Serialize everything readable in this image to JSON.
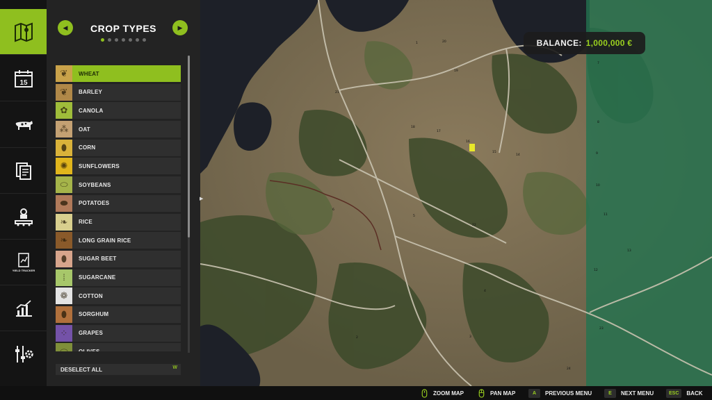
{
  "sidebar": {
    "items": [
      {
        "name": "map-icon",
        "active": true
      },
      {
        "name": "calendar-icon",
        "day": "15"
      },
      {
        "name": "cow-icon"
      },
      {
        "name": "documents-icon"
      },
      {
        "name": "production-icon"
      },
      {
        "name": "yield-tracker-icon",
        "label": "YIELD TRACKER"
      },
      {
        "name": "statistics-icon"
      },
      {
        "name": "settings-icon"
      }
    ]
  },
  "panel": {
    "title": "CROP TYPES",
    "page_count": 7,
    "active_page": 1,
    "crops": [
      {
        "label": "WHEAT",
        "glyph": "❦",
        "color": "#c9a24a",
        "selected": true
      },
      {
        "label": "BARLEY",
        "glyph": "❦",
        "color": "#b08848"
      },
      {
        "label": "CANOLA",
        "glyph": "✿",
        "color": "#9fbd3a"
      },
      {
        "label": "OAT",
        "glyph": "⁂",
        "color": "#c4a173"
      },
      {
        "label": "CORN",
        "glyph": "⬮",
        "color": "#d9b23a"
      },
      {
        "label": "SUNFLOWERS",
        "glyph": "✺",
        "color": "#e0b51c"
      },
      {
        "label": "SOYBEANS",
        "glyph": "⬭",
        "color": "#a5b44a"
      },
      {
        "label": "POTATOES",
        "glyph": "⬬",
        "color": "#b07a5a"
      },
      {
        "label": "RICE",
        "glyph": "❧",
        "color": "#d8cf8e"
      },
      {
        "label": "LONG GRAIN RICE",
        "glyph": "❧",
        "color": "#8a5a2a"
      },
      {
        "label": "SUGAR BEET",
        "glyph": "⬮",
        "color": "#d7a58c"
      },
      {
        "label": "SUGARCANE",
        "glyph": "⁞",
        "color": "#a7c76a"
      },
      {
        "label": "COTTON",
        "glyph": "❁",
        "color": "#e4e4e4"
      },
      {
        "label": "SORGHUM",
        "glyph": "⬮",
        "color": "#b0703c"
      },
      {
        "label": "GRAPES",
        "glyph": "⁘",
        "color": "#7452a8"
      },
      {
        "label": "OLIVES",
        "glyph": "⬭",
        "color": "#7f8f3a"
      }
    ],
    "deselect_label": "DESELECT ALL",
    "deselect_key": "W"
  },
  "balance": {
    "label": "BALANCE:",
    "value": "1,000,000 €"
  },
  "map": {
    "field_numbers": [
      "1",
      "20",
      "19",
      "21",
      "18",
      "17",
      "16",
      "15",
      "14",
      "6",
      "5",
      "22",
      "4",
      "3",
      "2",
      "24",
      "23",
      "7",
      "8",
      "9",
      "10",
      "11",
      "12",
      "13"
    ]
  },
  "bottom_hints": [
    {
      "key": "mouse-wheel",
      "label": "ZOOM MAP"
    },
    {
      "key": "mouse-drag",
      "label": "PAN MAP"
    },
    {
      "key": "A",
      "label": "PREVIOUS MENU"
    },
    {
      "key": "E",
      "label": "NEXT MENU"
    },
    {
      "key": "ESC",
      "label": "BACK"
    }
  ],
  "colors": {
    "accent": "#8fbf1f",
    "balance_value": "#9bd11f",
    "panel_bg": "#232323",
    "iconbar_bg": "#141414"
  }
}
